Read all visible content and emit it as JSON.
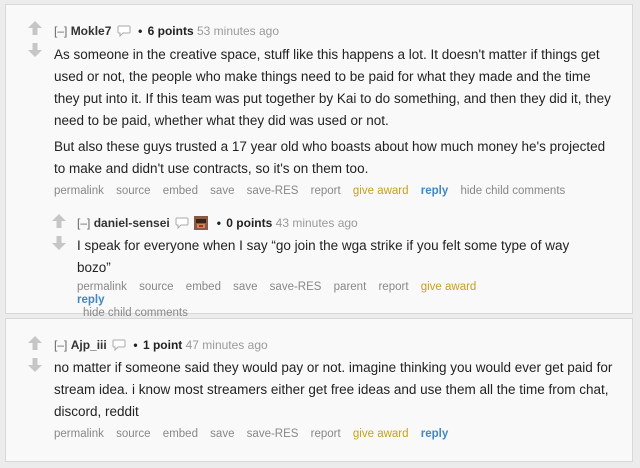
{
  "comments": [
    {
      "expand": "[–]",
      "author": "Mokle7",
      "points": "6 points",
      "time": "53 minutes ago",
      "paragraphs": [
        "As someone in the creative space, stuff like this happens a lot. It doesn't matter if things get used or not, the people who make things need to be paid for what they made and the time they put into it. If this team was put together by Kai to do something, and then they did it, they need to be paid, whether what they did was used or not.",
        "But also these guys trusted a 17 year old who boasts about how much money he's projected to make and didn't use contracts, so it's on them too."
      ],
      "buttons": [
        "permalink",
        "source",
        "embed",
        "save",
        "save-RES",
        "report",
        "give award",
        "reply",
        "hide child comments"
      ]
    },
    {
      "expand": "[–]",
      "author": "daniel-sensei",
      "points": "0 points",
      "time": "43 minutes ago",
      "paragraphs": [
        "I speak for everyone when I say “go join the wga strike if you felt some type of way bozo”"
      ],
      "buttons": [
        "permalink",
        "source",
        "embed",
        "save",
        "save-RES",
        "parent",
        "report",
        "give award",
        "reply",
        "hide child comments"
      ]
    },
    {
      "expand": "[–]",
      "author": "Ajp_iii",
      "points": "1 point",
      "time": "47 minutes ago",
      "paragraphs": [
        "no matter if someone said they would pay or not. imagine thinking you would ever get paid for stream idea. i know most streamers either get free ideas and use them all the time from chat, discord, reddit"
      ],
      "buttons": [
        "permalink",
        "source",
        "embed",
        "save",
        "save-RES",
        "report",
        "give award",
        "reply"
      ]
    }
  ],
  "colors": {
    "background": "#ececec",
    "card": "#f9f9f9",
    "give_award": "#c4a21c",
    "reply": "#3f88c5"
  }
}
